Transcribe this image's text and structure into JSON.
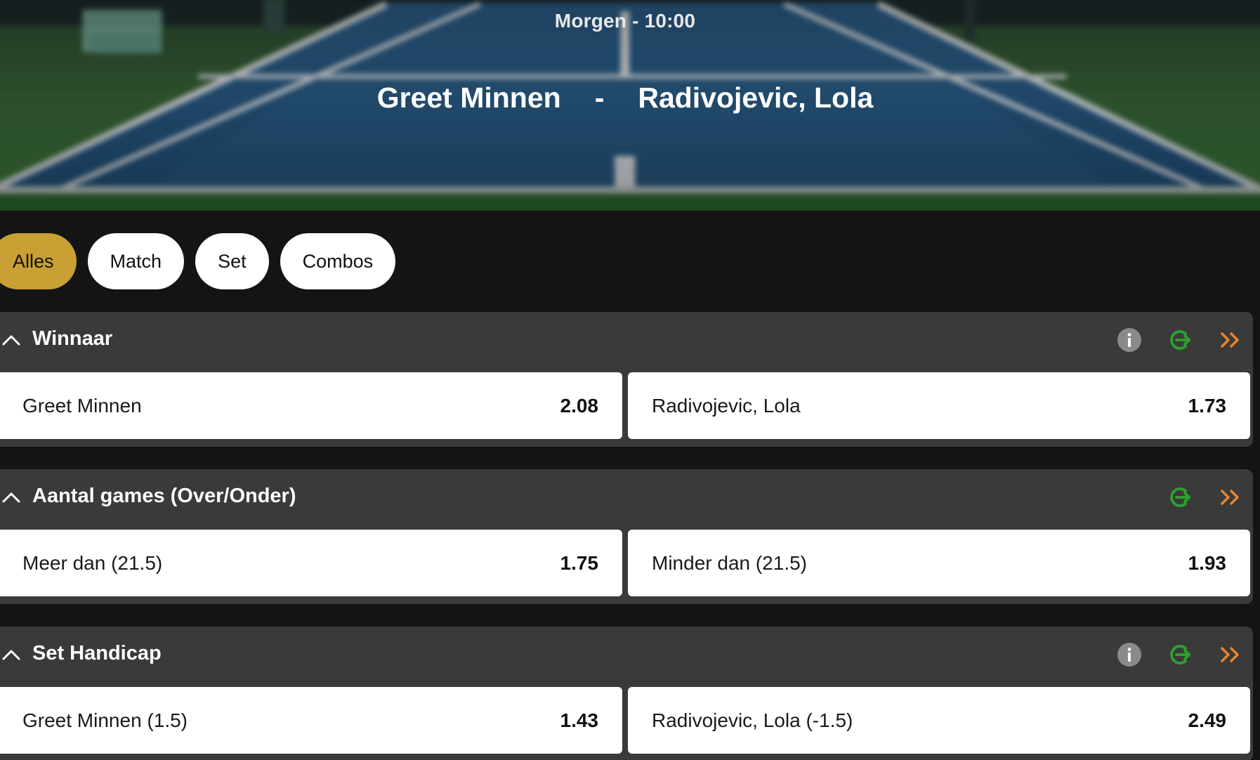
{
  "event": {
    "time": "Morgen - 10:00",
    "player_home": "Greet Minnen",
    "separator": "-",
    "player_away": "Radivojevic, Lola"
  },
  "tabs": [
    {
      "label": "Alles",
      "active": true
    },
    {
      "label": "Match",
      "active": false
    },
    {
      "label": "Set",
      "active": false
    },
    {
      "label": "Combos",
      "active": false
    }
  ],
  "markets": [
    {
      "title": "Winnaar",
      "icons": [
        "info-icon",
        "cash-out-icon",
        "double-chevron-right-icon"
      ],
      "outcomes": [
        {
          "label": "Greet Minnen",
          "odds": "2.08"
        },
        {
          "label": "Radivojevic, Lola",
          "odds": "1.73"
        }
      ]
    },
    {
      "title": "Aantal games (Over/Onder)",
      "icons": [
        "cash-out-icon",
        "double-chevron-right-icon"
      ],
      "outcomes": [
        {
          "label": "Meer dan (21.5)",
          "odds": "1.75"
        },
        {
          "label": "Minder dan (21.5)",
          "odds": "1.93"
        }
      ]
    },
    {
      "title": "Set Handicap",
      "icons": [
        "info-icon",
        "cash-out-icon",
        "double-chevron-right-icon"
      ],
      "outcomes": [
        {
          "label": "Greet Minnen (1.5)",
          "odds": "1.43"
        },
        {
          "label": "Radivojevic, Lola (-1.5)",
          "odds": "2.49"
        }
      ]
    }
  ],
  "colors": {
    "page_bg": "#141414",
    "market_bg": "#3a3a3a",
    "active_tab": "#c9a034",
    "cash_out_green": "#2e9e2e",
    "chevron_orange": "#e8852a",
    "info_grey": "#8a8a8a"
  }
}
